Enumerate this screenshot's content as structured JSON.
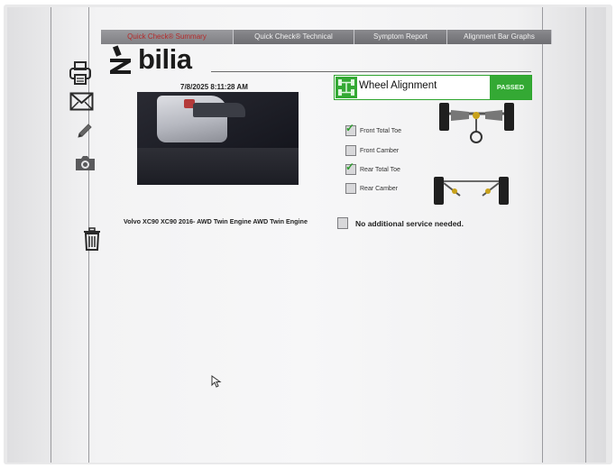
{
  "tabs": [
    {
      "label": "Quick Check® Summary",
      "active": true
    },
    {
      "label": "Quick Check® Technical",
      "active": false
    },
    {
      "label": "Symptom Report",
      "active": false
    },
    {
      "label": "Alignment Bar Graphs",
      "active": false
    }
  ],
  "logo": {
    "text": "bilia"
  },
  "sidebar": {
    "icons": [
      "printer-icon",
      "mail-icon",
      "pencil-icon",
      "camera-icon",
      "trash-icon"
    ]
  },
  "photo": {
    "timestamp": "7/8/2025 8:11:28 AM"
  },
  "vehicle": {
    "description": "Volvo XC90 XC90 2016- AWD Twin Engine AWD Twin Engine"
  },
  "alignment": {
    "title": "Wheel Alignment",
    "status": "PASSED",
    "checks": [
      {
        "label": "Front Total Toe",
        "checked": true
      },
      {
        "label": "Front Camber",
        "checked": false
      },
      {
        "label": "Rear Total Toe",
        "checked": true
      },
      {
        "label": "Rear Camber",
        "checked": false
      }
    ]
  },
  "service": {
    "text": "No additional service needed.",
    "checked": false
  },
  "colors": {
    "accent_green": "#34a934",
    "active_tab_text": "#b42a2a",
    "tab_bg": "#7a7a7e"
  }
}
